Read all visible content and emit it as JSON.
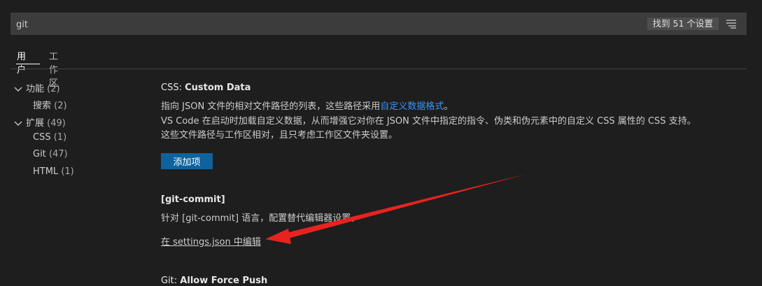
{
  "search": {
    "value": "git",
    "result_count": "找到 51 个设置"
  },
  "icons": {
    "filter": "filter-list-icon",
    "chevron": "chevron-down-icon"
  },
  "tabs": [
    {
      "label": "用户",
      "active": true
    },
    {
      "label": "工作区",
      "active": false
    }
  ],
  "toc": [
    {
      "label": "功能",
      "count": "(2)",
      "expanded": true
    },
    {
      "label": "搜索",
      "count": "(2)"
    },
    {
      "label": "扩展",
      "count": "(49)",
      "expanded": true
    },
    {
      "label": "CSS",
      "count": "(1)"
    },
    {
      "label": "Git",
      "count": "(47)"
    },
    {
      "label": "HTML",
      "count": "(1)"
    }
  ],
  "settings": {
    "css_custom_data": {
      "category": "CSS: ",
      "name": "Custom Data",
      "desc_line1_prefix": "指向 JSON 文件的相对文件路径的列表，这些路径采用",
      "desc_line1_link": "自定义数据格式",
      "desc_line1_suffix": "。",
      "desc_line2": "VS Code 在启动时加载自定义数据，从而增强它对你在 JSON 文件中指定的指令、伪类和伪元素中的自定义 CSS 属性的 CSS 支持。",
      "desc_line3": "这些文件路径与工作区相对，且只考虑工作区文件夹设置。",
      "add_button": "添加项"
    },
    "git_commit": {
      "title": "[git-commit]",
      "desc": "针对 [git-commit] 语言，配置替代编辑器设置。",
      "edit_link": "在 settings.json 中编辑"
    },
    "git_allow_force_push": {
      "category": "Git: ",
      "name": "Allow Force Push"
    }
  },
  "colors": {
    "background": "#1e1e1e",
    "accent_button": "#0e639c",
    "link": "#3794ff",
    "annotation_arrow": "#e8231f"
  }
}
